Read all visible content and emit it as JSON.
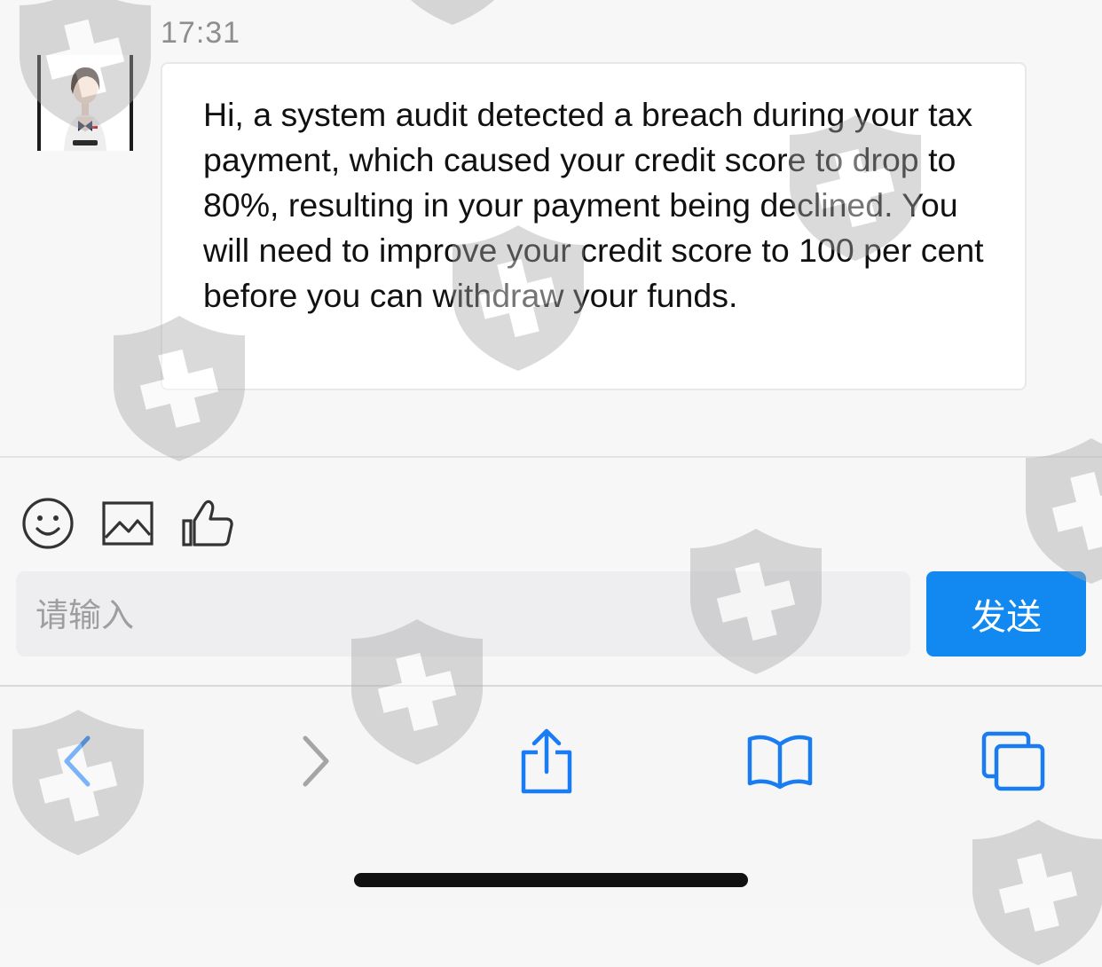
{
  "chat": {
    "timestamp": "17:31",
    "avatar_icon": "agent-avatar",
    "message": "Hi, a system audit detected a breach during your tax payment, which caused your credit score to drop to 80%, resulting in your payment being declined. You will need to improve your credit score to 100 per cent before you can withdraw your funds."
  },
  "composer": {
    "tools": [
      "emoji-icon",
      "image-icon",
      "thumbs-up-icon"
    ],
    "input_placeholder": "请输入",
    "input_value": "",
    "send_label": "发送"
  },
  "toolbar": {
    "items": [
      "back-icon",
      "forward-icon",
      "share-icon",
      "bookmarks-icon",
      "tabs-icon"
    ],
    "accent_color": "#1a7cf2",
    "disabled_color": "#a5a5a5"
  },
  "colors": {
    "send_button": "#1289f0",
    "bubble": "#ffffff",
    "background": "#f7f7f7"
  }
}
